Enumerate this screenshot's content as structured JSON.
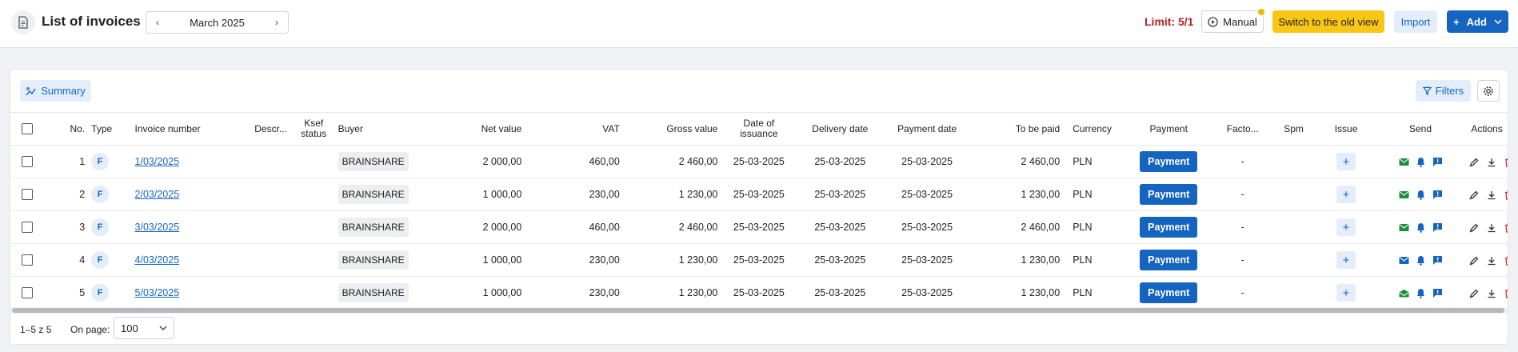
{
  "header": {
    "title": "List of invoices",
    "month": "March 2025",
    "limit": "Limit: 5/1",
    "manual_label": "Manual",
    "old_view_label": "Switch to the old view",
    "import_label": "Import",
    "add_label": "Add"
  },
  "toolbar": {
    "summary_label": "Summary",
    "filters_label": "Filters"
  },
  "columns": {
    "no": "No.",
    "type": "Type",
    "invoice_number": "Invoice number",
    "descr": "Descr...",
    "ksef_line1": "Ksef",
    "ksef_line2": "status",
    "buyer": "Buyer",
    "net": "Net value",
    "vat": "VAT",
    "gross": "Gross value",
    "issuance_line1": "Date of",
    "issuance_line2": "issuance",
    "delivery": "Delivery date",
    "payment_date": "Payment date",
    "to_be_paid": "To be paid",
    "currency": "Currency",
    "payment": "Payment",
    "facto": "Facto...",
    "spm": "Spm",
    "issue": "Issue",
    "send": "Send",
    "actions": "Actions"
  },
  "rows": [
    {
      "no": "1",
      "type": "F",
      "number": "1/03/2025",
      "buyer": "BRAINSHARE",
      "net": "2 000,00",
      "vat": "460,00",
      "gross": "2 460,00",
      "issued": "25-03-2025",
      "delivery": "25-03-2025",
      "payment_date": "25-03-2025",
      "to_be_paid": "2 460,00",
      "currency": "PLN",
      "payment": "Payment",
      "facto": "-",
      "issue": "+"
    },
    {
      "no": "2",
      "type": "F",
      "number": "2/03/2025",
      "buyer": "BRAINSHARE",
      "net": "1 000,00",
      "vat": "230,00",
      "gross": "1 230,00",
      "issued": "25-03-2025",
      "delivery": "25-03-2025",
      "payment_date": "25-03-2025",
      "to_be_paid": "1 230,00",
      "currency": "PLN",
      "payment": "Payment",
      "facto": "-",
      "issue": "+"
    },
    {
      "no": "3",
      "type": "F",
      "number": "3/03/2025",
      "buyer": "BRAINSHARE",
      "net": "2 000,00",
      "vat": "460,00",
      "gross": "2 460,00",
      "issued": "25-03-2025",
      "delivery": "25-03-2025",
      "payment_date": "25-03-2025",
      "to_be_paid": "2 460,00",
      "currency": "PLN",
      "payment": "Payment",
      "facto": "-",
      "issue": "+"
    },
    {
      "no": "4",
      "type": "F",
      "number": "4/03/2025",
      "buyer": "BRAINSHARE",
      "net": "1 000,00",
      "vat": "230,00",
      "gross": "1 230,00",
      "issued": "25-03-2025",
      "delivery": "25-03-2025",
      "payment_date": "25-03-2025",
      "to_be_paid": "1 230,00",
      "currency": "PLN",
      "payment": "Payment",
      "facto": "-",
      "issue": "+"
    },
    {
      "no": "5",
      "type": "F",
      "number": "5/03/2025",
      "buyer": "BRAINSHARE",
      "net": "1 000,00",
      "vat": "230,00",
      "gross": "1 230,00",
      "issued": "25-03-2025",
      "delivery": "25-03-2025",
      "payment_date": "25-03-2025",
      "to_be_paid": "1 230,00",
      "currency": "PLN",
      "payment": "Payment",
      "facto": "-",
      "issue": "+"
    }
  ],
  "footer": {
    "count": "1–5 z 5",
    "on_page_label": "On page:",
    "per_page": "100"
  },
  "colors": {
    "primary": "#1565c0",
    "limit": "#b32024",
    "old_view": "#f8c613",
    "mail_sent": "#1e8e3e",
    "mail_pending": "#1565c0",
    "delete": "#d32f2f"
  }
}
